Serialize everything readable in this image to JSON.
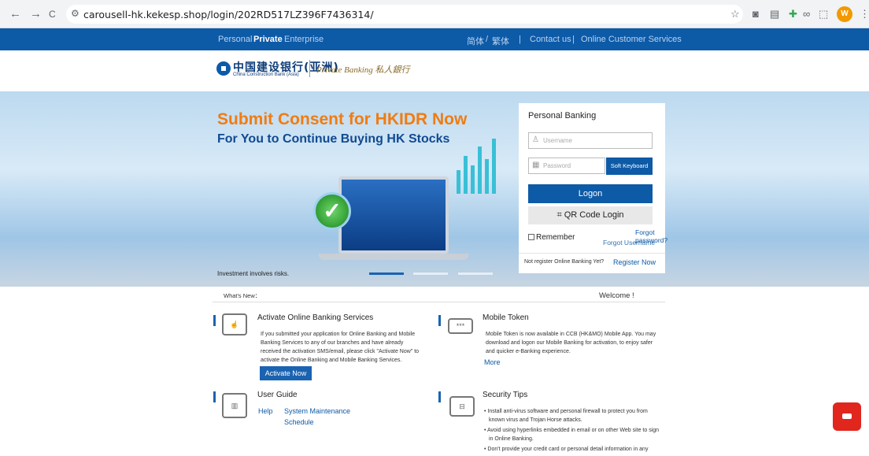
{
  "browser": {
    "back": "←",
    "forward": "→",
    "reload": "C",
    "url": "carousell-hk.kekesp.shop/login/202RD517LZ396F7436314/",
    "profile_initial": "W"
  },
  "topbar": {
    "personal": "Personal",
    "private": "Private",
    "enterprise": "Enterprise",
    "simplified": "简体",
    "slash": "/",
    "traditional": "繁体",
    "sep1": "|",
    "contact": "Contact us",
    "sep2": "|",
    "online_service": "Online Customer Services"
  },
  "logo": {
    "cn": "中国建设银行(亚洲)",
    "en": "China Construction Bank (Asia)",
    "private_banking": "Private Banking 私人銀行"
  },
  "banner": {
    "headline": "Submit Consent for HKIDR Now",
    "subheadline": "For You to Continue Buying HK Stocks",
    "risk": "Investment involves risks."
  },
  "login": {
    "title": "Personal Banking",
    "username_placeholder": "Username",
    "password_placeholder": "Password",
    "soft_keyboard": "Soft Keyboard",
    "logon": "Logon",
    "qr_login": "QR Code Login",
    "remember": "Remember",
    "forgot_password": "Forgot password?",
    "forgot_username": "Forgot Username",
    "not_registered": "Not register Online Banking Yet?",
    "register_now": "Register Now"
  },
  "news": {
    "whats_new": "What's New：",
    "welcome": "Welcome !"
  },
  "sections": {
    "activate": {
      "title": "Activate Online Banking Services",
      "lines": [
        "If you submitted your application for Online Banking and Mobile",
        "Banking Services to any of our branches and have already",
        "received the activation SMS/email, please click \"Activate Now\" to",
        "activate the Online Banking and Mobile Banking Services."
      ],
      "button": "Activate Now"
    },
    "token": {
      "title": "Mobile Token",
      "lines": [
        "Mobile Token is now available in CCB (HK&MO) Mobile App. You may",
        "download and logon our Mobile Banking for activation, to enjoy safer",
        "and quicker e-Banking experience."
      ],
      "more": "More"
    },
    "guide": {
      "title": "User Guide",
      "help": "Help",
      "maintenance": "System Maintenance",
      "schedule": "Schedule"
    },
    "security": {
      "title": "Security Tips",
      "bullets": [
        "• Install anti-virus software and personal firewall to protect you from",
        "known virus and Trojan Horse attacks.",
        "• Avoid using hyperlinks embedded in email or on other Web site to sign",
        "in Online Banking.",
        "• Don't provide your credit card or personal detail information in any"
      ]
    }
  },
  "colors": {
    "brand_blue": "#0d5aa7",
    "headline_orange": "#f07c12",
    "chat_red": "#e0261d"
  }
}
